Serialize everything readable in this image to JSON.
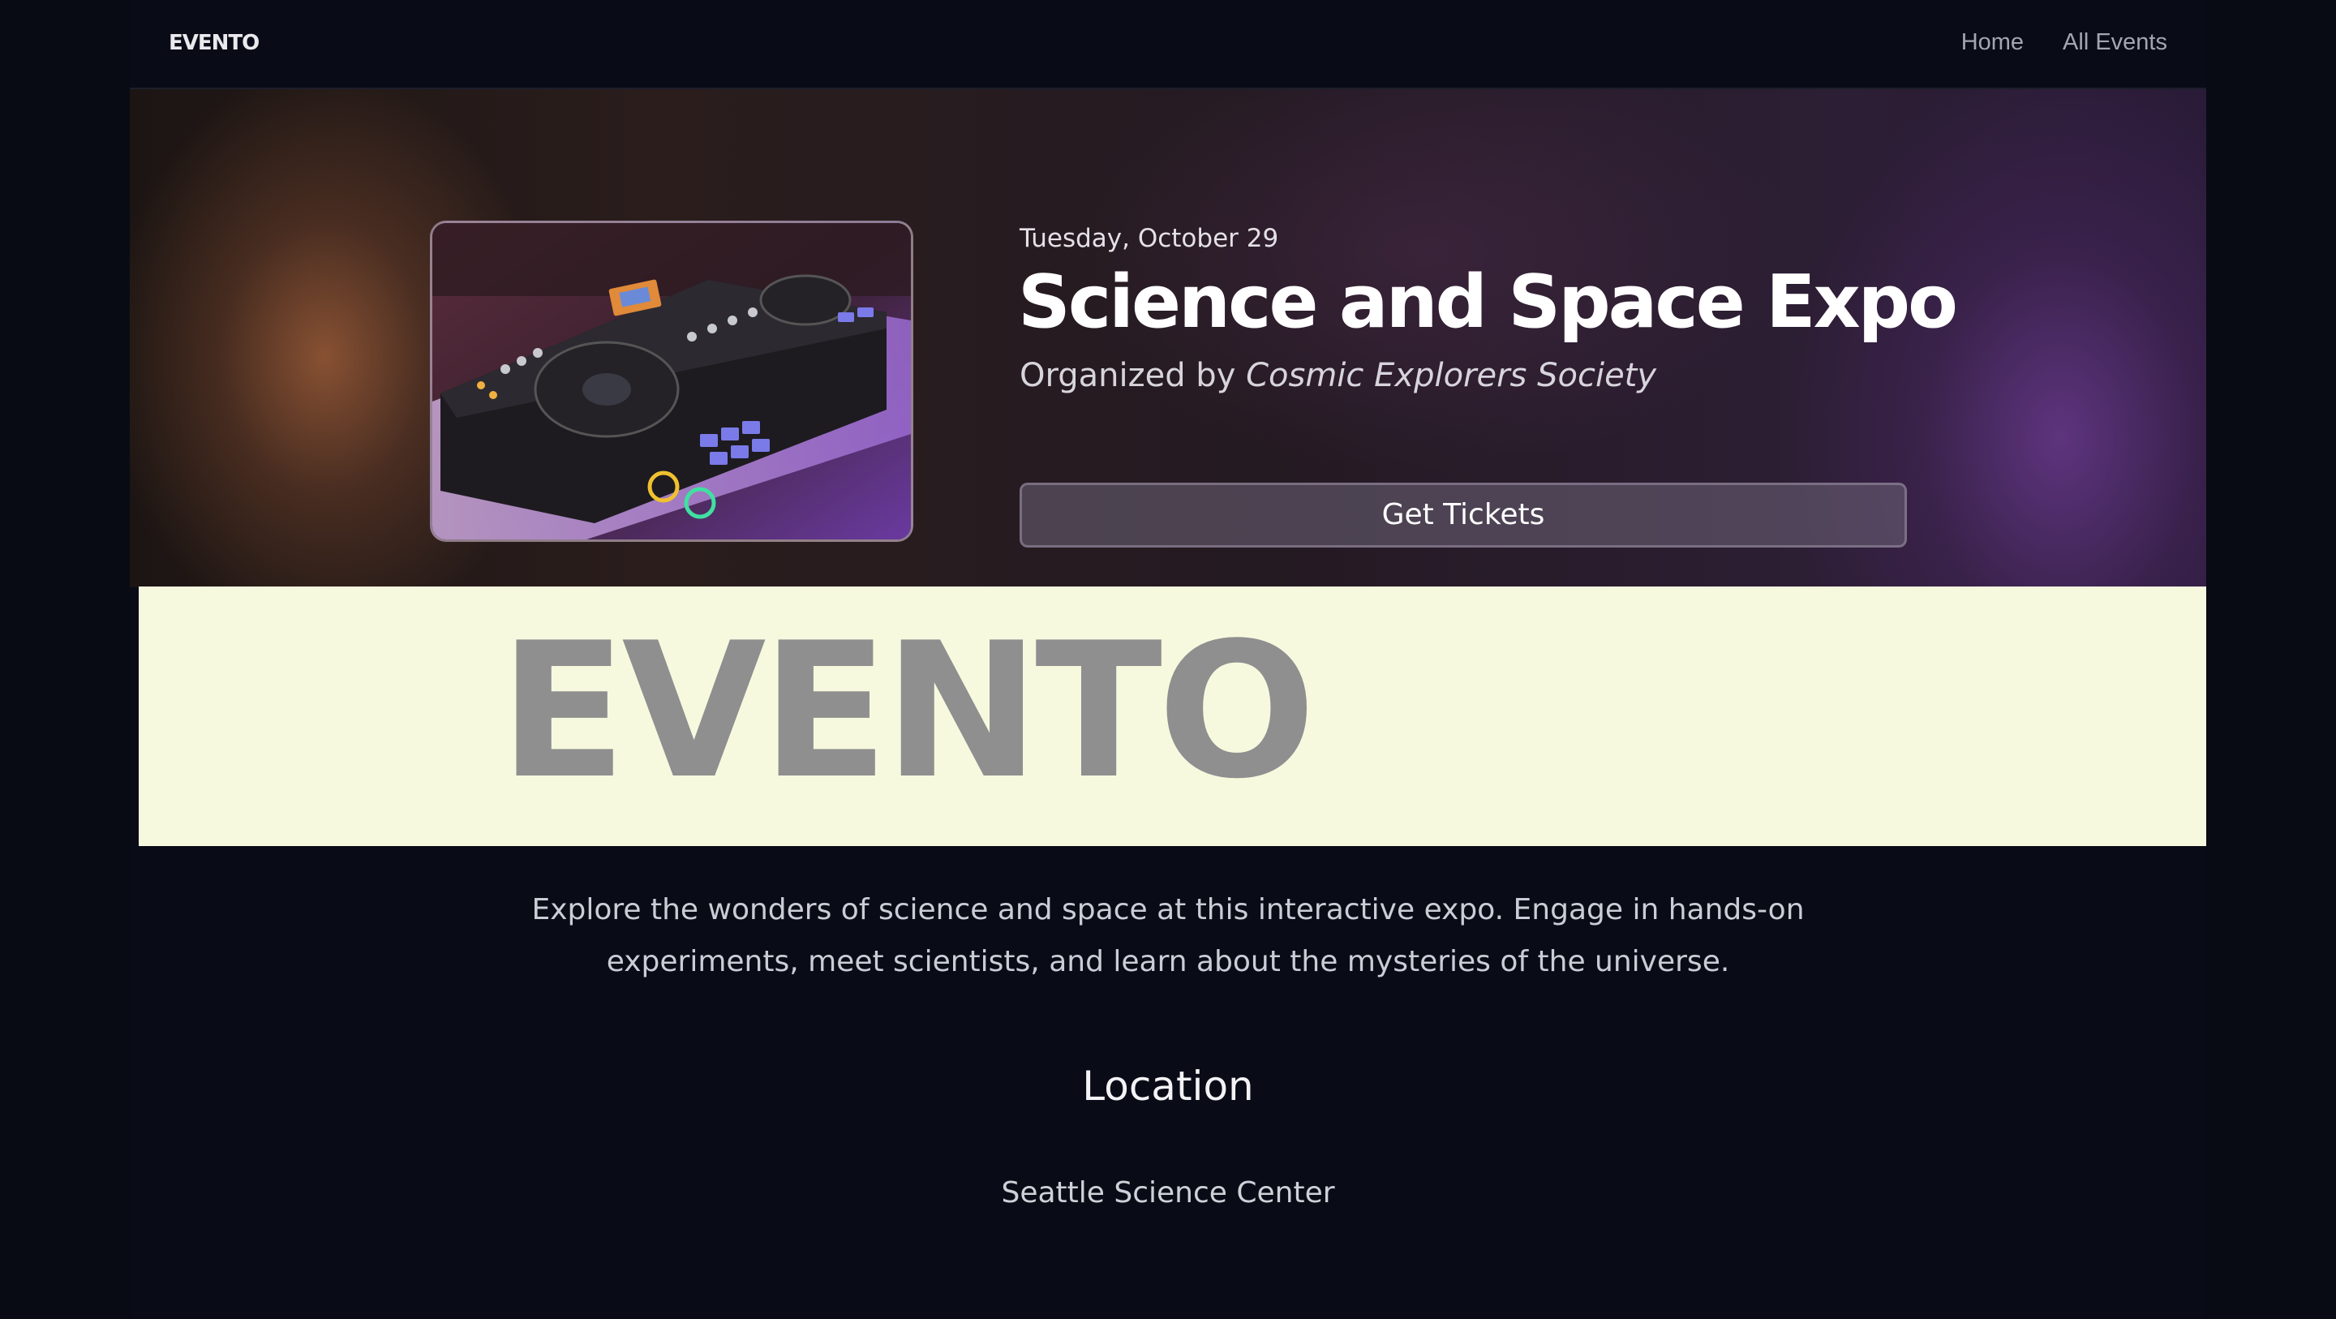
{
  "nav": {
    "brand": "EVENTO",
    "links": [
      "Home",
      "All Events"
    ]
  },
  "hero": {
    "image_alt": "DJ controller",
    "date": "Tuesday, October 29",
    "title": "Science and Space Expo",
    "organizer_prefix": "Organized by",
    "organizer_name": "Cosmic Explorers Society",
    "tickets_label": "Get Tickets"
  },
  "banner": {
    "text": "EVENTO"
  },
  "description": "Explore the wonders of science and space at this interactive expo. Engage in hands-on experiments, meet scientists, and learn about the mysteries of the universe.",
  "location": {
    "heading": "Location",
    "value": "Seattle Science Center"
  }
}
